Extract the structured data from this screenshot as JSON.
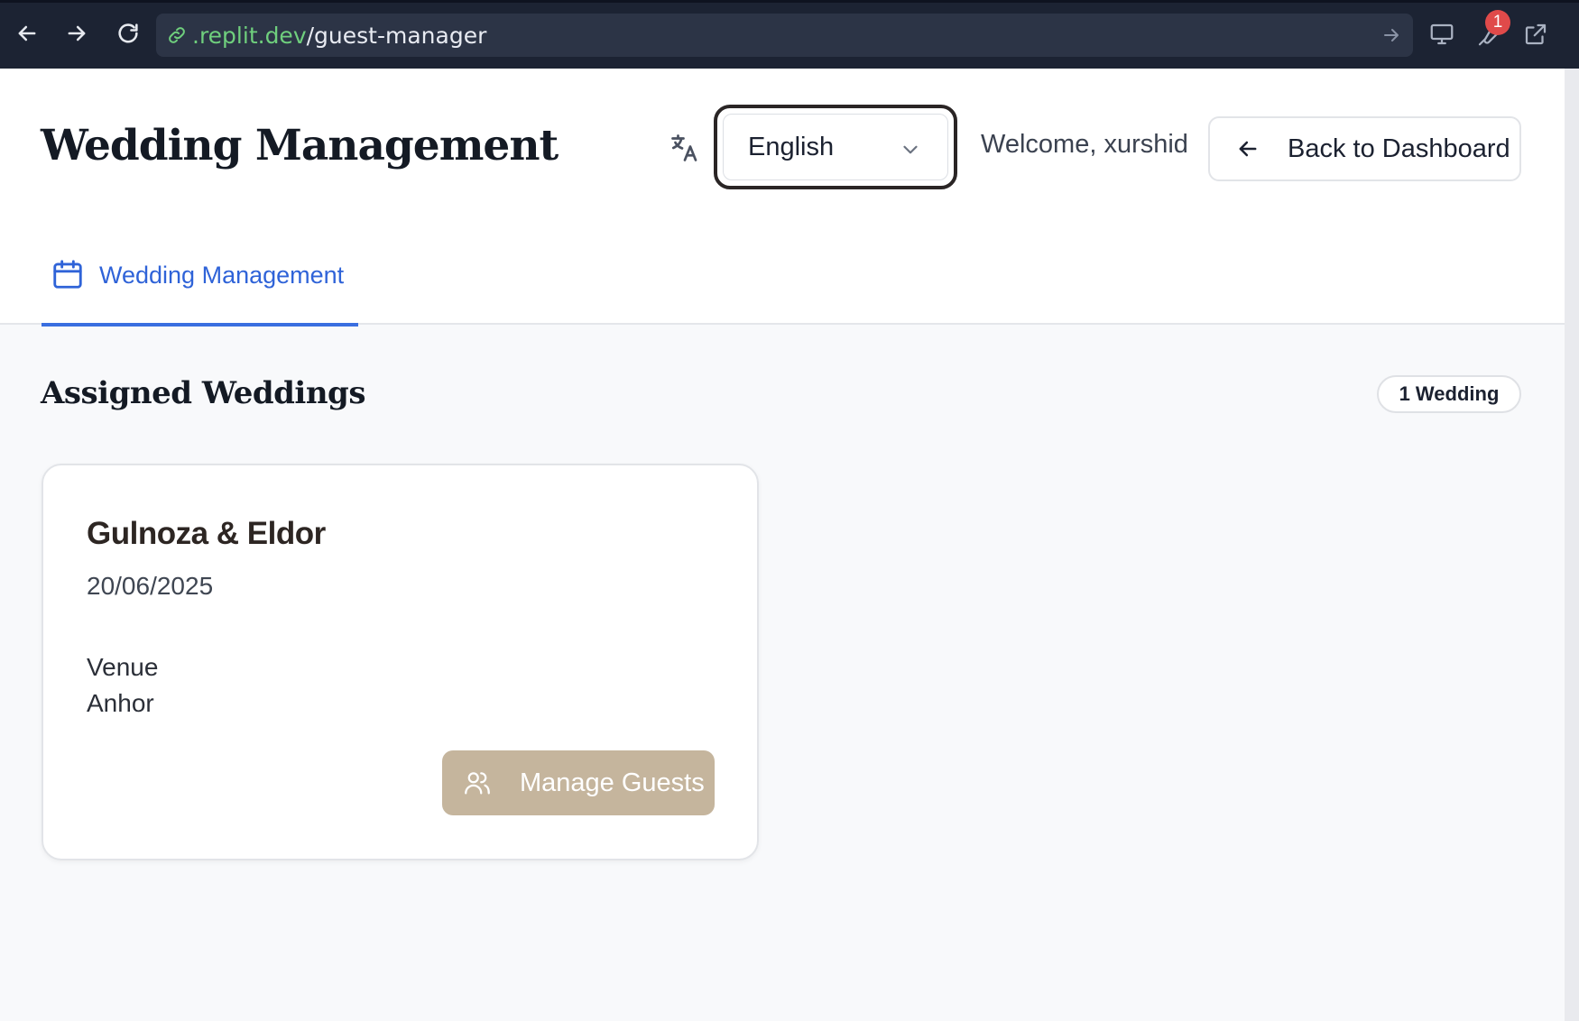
{
  "browser": {
    "url_host": ".replit.dev",
    "url_path": "/guest-manager",
    "notification_count": "1"
  },
  "header": {
    "title": "Wedding Management",
    "language": {
      "selected": "English"
    },
    "welcome": "Welcome, xurshid",
    "back_label": "Back to Dashboard"
  },
  "tabs": [
    {
      "label": "Wedding Management",
      "active": true
    }
  ],
  "section": {
    "title": "Assigned Weddings",
    "count_label": "1 Wedding"
  },
  "weddings": [
    {
      "names": "Gulnoza & Eldor",
      "date": "20/06/2025",
      "venue_label": "Venue",
      "venue": "Anhor",
      "action_label": "Manage Guests"
    }
  ],
  "colors": {
    "accent_blue": "#3a6ee0",
    "manage_button": "#c5b59d",
    "chrome_bg": "#1c2333",
    "url_host": "#6fcf7d",
    "badge": "#e04a4a"
  }
}
